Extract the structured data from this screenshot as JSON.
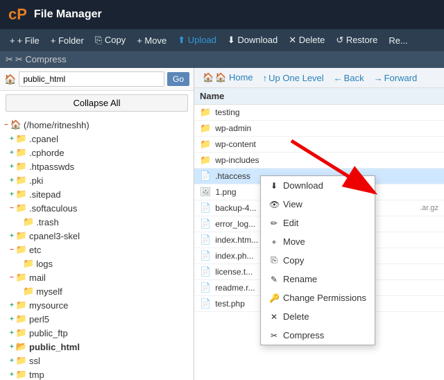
{
  "header": {
    "logo": "cP",
    "title": "File Manager"
  },
  "toolbar": {
    "items": [
      {
        "label": "+ File",
        "icon": "+",
        "name": "file-btn"
      },
      {
        "label": "+ Folder",
        "icon": "+",
        "name": "folder-btn"
      },
      {
        "label": "⎘ Copy",
        "icon": "⎘",
        "name": "copy-btn"
      },
      {
        "label": "+ Move",
        "icon": "+",
        "name": "move-btn"
      },
      {
        "label": "⬆ Upload",
        "icon": "⬆",
        "name": "upload-btn"
      },
      {
        "label": "⬇ Download",
        "icon": "⬇",
        "name": "download-btn"
      },
      {
        "label": "✕ Delete",
        "icon": "✕",
        "name": "delete-btn"
      },
      {
        "label": "↺ Restore",
        "icon": "↺",
        "name": "restore-btn"
      },
      {
        "label": "Re...",
        "icon": "",
        "name": "more-btn"
      }
    ],
    "compress_label": "✂ Compress"
  },
  "left_panel": {
    "path": "public_html",
    "go_label": "Go",
    "collapse_label": "Collapse All",
    "tree": [
      {
        "label": "(/home/ritneshh)",
        "indent": 0,
        "type": "root",
        "icon": "🏠",
        "expanded": true
      },
      {
        "label": ".cpanel",
        "indent": 1,
        "type": "folder"
      },
      {
        "label": ".cphorde",
        "indent": 1,
        "type": "folder"
      },
      {
        "label": ".htpasswds",
        "indent": 1,
        "type": "folder"
      },
      {
        "label": ".pki",
        "indent": 1,
        "type": "folder"
      },
      {
        "label": ".sitepad",
        "indent": 1,
        "type": "folder"
      },
      {
        "label": ".softaculous",
        "indent": 1,
        "type": "folder"
      },
      {
        "label": ".trash",
        "indent": 2,
        "type": "folder"
      },
      {
        "label": "cpanel3-skel",
        "indent": 1,
        "type": "folder"
      },
      {
        "label": "etc",
        "indent": 1,
        "type": "folder"
      },
      {
        "label": "logs",
        "indent": 2,
        "type": "folder"
      },
      {
        "label": "mail",
        "indent": 1,
        "type": "folder"
      },
      {
        "label": "myself",
        "indent": 2,
        "type": "folder"
      },
      {
        "label": "mysource",
        "indent": 1,
        "type": "folder"
      },
      {
        "label": "perl5",
        "indent": 1,
        "type": "folder"
      },
      {
        "label": "public_ftp",
        "indent": 1,
        "type": "folder"
      },
      {
        "label": "public_html",
        "indent": 1,
        "type": "folder",
        "bold": true
      },
      {
        "label": "ssl",
        "indent": 1,
        "type": "folder"
      },
      {
        "label": "tmp",
        "indent": 1,
        "type": "folder"
      }
    ]
  },
  "right_panel": {
    "nav": {
      "home": "🏠 Home",
      "up": "↑ Up One Level",
      "back": "← Back",
      "forward": "→ Forward"
    },
    "column_header": "Name",
    "files": [
      {
        "name": "testing",
        "type": "folder",
        "selected": false
      },
      {
        "name": "wp-admin",
        "type": "folder"
      },
      {
        "name": "wp-content",
        "type": "folder"
      },
      {
        "name": "wp-includes",
        "type": "folder"
      },
      {
        "name": ".htaccess",
        "type": "htaccess",
        "context": true
      },
      {
        "name": "1.png",
        "type": "file"
      },
      {
        "name": "backup-4...",
        "type": "file"
      },
      {
        "name": "error_log...",
        "type": "file"
      },
      {
        "name": "index.htm...",
        "type": "file"
      },
      {
        "name": "index.ph...",
        "type": "php"
      },
      {
        "name": "license.t...",
        "type": "file"
      },
      {
        "name": "readme.r...",
        "type": "file"
      },
      {
        "name": "test.php",
        "type": "php"
      }
    ]
  },
  "context_menu": {
    "items": [
      {
        "label": "⬇ Download",
        "name": "ctx-download"
      },
      {
        "label": "👁 View",
        "name": "ctx-view"
      },
      {
        "label": "✏ Edit",
        "name": "ctx-edit"
      },
      {
        "label": "+ Move",
        "name": "ctx-move"
      },
      {
        "label": "⎘ Copy",
        "name": "ctx-copy"
      },
      {
        "label": "✎ Rename",
        "name": "ctx-rename"
      },
      {
        "label": "🔑 Change Permissions",
        "name": "ctx-permissions"
      },
      {
        "label": "✕ Delete",
        "name": "ctx-delete"
      },
      {
        "label": "✂ Compress",
        "name": "ctx-compress"
      }
    ]
  }
}
